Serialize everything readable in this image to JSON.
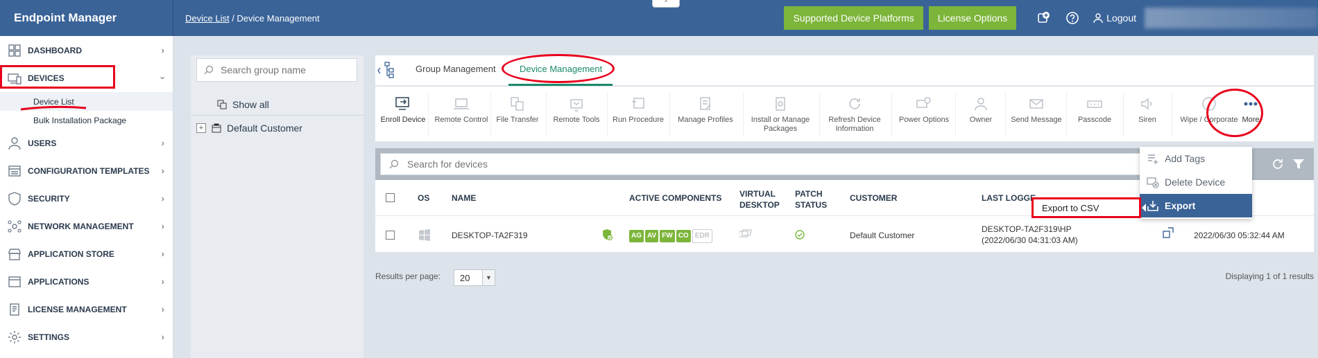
{
  "header": {
    "brand": "Endpoint Manager",
    "breadcrumb_link": "Device List",
    "breadcrumb_sep": " / ",
    "breadcrumb_current": "Device Management",
    "btn_platforms": "Supported Device Platforms",
    "btn_license": "License Options",
    "logout": "Logout",
    "collapse_glyph": "⌃"
  },
  "sidebar": {
    "items": [
      {
        "label": "DASHBOARD",
        "icon": "dashboard-icon"
      },
      {
        "label": "DEVICES",
        "icon": "devices-icon"
      },
      {
        "label": "USERS",
        "icon": "user-icon"
      },
      {
        "label": "CONFIGURATION TEMPLATES",
        "icon": "templates-icon"
      },
      {
        "label": "SECURITY",
        "icon": "shield-icon"
      },
      {
        "label": "NETWORK MANAGEMENT",
        "icon": "network-icon"
      },
      {
        "label": "APPLICATION STORE",
        "icon": "store-icon"
      },
      {
        "label": "APPLICATIONS",
        "icon": "applications-icon"
      },
      {
        "label": "LICENSE MANAGEMENT",
        "icon": "license-icon"
      },
      {
        "label": "SETTINGS",
        "icon": "gear-icon"
      }
    ],
    "sub_items": [
      "Device List",
      "Bulk Installation Package"
    ]
  },
  "groups": {
    "search_placeholder": "Search group name",
    "show_all": "Show all",
    "default_customer": "Default Customer"
  },
  "tabs": {
    "group_management": "Group Management",
    "device_management": "Device Management"
  },
  "toolbar": [
    {
      "label": "Enroll Device",
      "icon": "enroll-device-icon"
    },
    {
      "label": "Remote Control",
      "icon": "laptop-icon"
    },
    {
      "label": "File Transfer",
      "icon": "file-transfer-icon"
    },
    {
      "label": "Remote Tools",
      "icon": "remote-tools-icon"
    },
    {
      "label": "Run Procedure",
      "icon": "run-procedure-icon"
    },
    {
      "label": "Manage Profiles",
      "icon": "manage-profiles-icon"
    },
    {
      "label": "Install or Manage\nPackages",
      "icon": "package-icon"
    },
    {
      "label": "Refresh Device\nInformation",
      "icon": "refresh-icon"
    },
    {
      "label": "Power Options",
      "icon": "power-icon"
    },
    {
      "label": "Owner",
      "icon": "owner-icon"
    },
    {
      "label": "Send Message",
      "icon": "envelope-icon"
    },
    {
      "label": "Passcode",
      "icon": "passcode-icon"
    },
    {
      "label": "Siren",
      "icon": "speaker-icon"
    },
    {
      "label": "Wipe / Corporate",
      "icon": "wipe-icon"
    },
    {
      "label": "More",
      "icon": "more-dots-icon"
    }
  ],
  "devices": {
    "search_placeholder": "Search for devices",
    "columns": {
      "os": "OS",
      "name": "NAME",
      "active_components": "ACTIVE COMPONENTS",
      "virtual_desktop": "VIRTUAL\nDESKTOP",
      "patch_status": "PATCH\nSTATUS",
      "customer": "CUSTOMER",
      "last_logged": "LAST LOGGE"
    },
    "rows": [
      {
        "name": "DESKTOP-TA2F319",
        "components": [
          "AG",
          "AV",
          "FW",
          "CO"
        ],
        "component_off": "EDR",
        "customer": "Default Customer",
        "last_logged_user": "DESKTOP-TA2F319\\HP",
        "last_logged_time": "(2022/06/30 04:31:03 AM)",
        "last_seen": "2022/06/30 05:32:44 AM"
      }
    ]
  },
  "pagination": {
    "results_label": "Results per page:",
    "per_page": "20",
    "displaying": "Displaying 1 of 1 results"
  },
  "menu": {
    "add_tags": "Add Tags",
    "delete_device": "Delete Device",
    "export": "Export",
    "export_csv": "Export to CSV"
  },
  "colors": {
    "header": "#3a6398",
    "green": "#7cb53a",
    "accent_tab": "#1b8a6b",
    "annotation_red": "#e8001c"
  }
}
